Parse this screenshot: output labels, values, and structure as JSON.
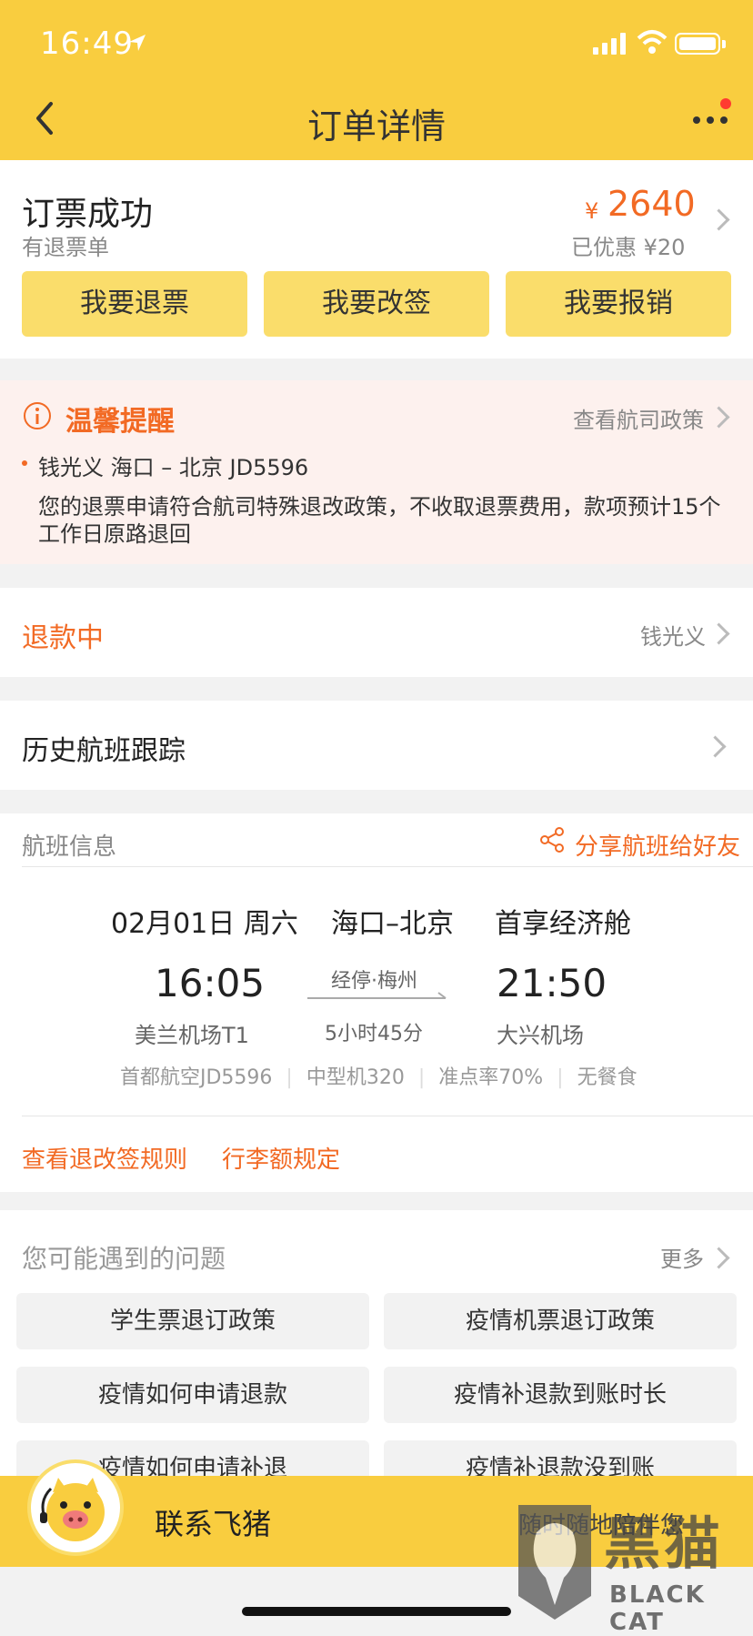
{
  "status_bar": {
    "time": "16:49"
  },
  "header": {
    "title": "订单详情"
  },
  "order": {
    "status": "订票成功",
    "substatus": "有退票单",
    "currency": "¥",
    "price": "2640",
    "discount": "已优惠 ¥20",
    "actions": [
      "我要退票",
      "我要改签",
      "我要报销"
    ]
  },
  "notice": {
    "title": "温馨提醒",
    "link": "查看航司政策",
    "passenger_line": "钱光义 海口 – 北京 JD5596",
    "message": "您的退票申请符合航司特殊退改政策，不收取退票费用，款项预计15个工作日原路退回"
  },
  "refund": {
    "status": "退款中",
    "passenger": "钱光义"
  },
  "history": {
    "label": "历史航班跟踪"
  },
  "flight": {
    "section_title": "航班信息",
    "share": "分享航班给好友",
    "date": "02月01日 周六",
    "route": "海口–北京",
    "cabin": "首享经济舱",
    "depart_time": "16:05",
    "depart_airport": "美兰机场T1",
    "stop": "经停·梅州",
    "duration": "5小时45分",
    "arrive_time": "21:50",
    "arrive_airport": "大兴机场",
    "details": [
      "首都航空JD5596",
      "中型机320",
      "准点率70%",
      "无餐食"
    ],
    "links": [
      "查看退改签规则",
      "行李额规定"
    ]
  },
  "faq": {
    "title": "您可能遇到的问题",
    "more": "更多",
    "items": [
      "学生票退订政策",
      "疫情机票退订政策",
      "疫情如何申请退款",
      "疫情补退款到账时长",
      "疫情如何申请补退",
      "疫情补退款没到账"
    ]
  },
  "footer": {
    "contact": "联系飞猪",
    "slogan": "随时随地陪伴您"
  },
  "watermark": {
    "cn": "黑猫",
    "en": "BLACK CAT"
  },
  "colors": {
    "brand_yellow": "#f9cd3f",
    "button_yellow": "#fadd6b",
    "accent_orange": "#f26a24",
    "notice_bg": "#fdf1ee"
  }
}
